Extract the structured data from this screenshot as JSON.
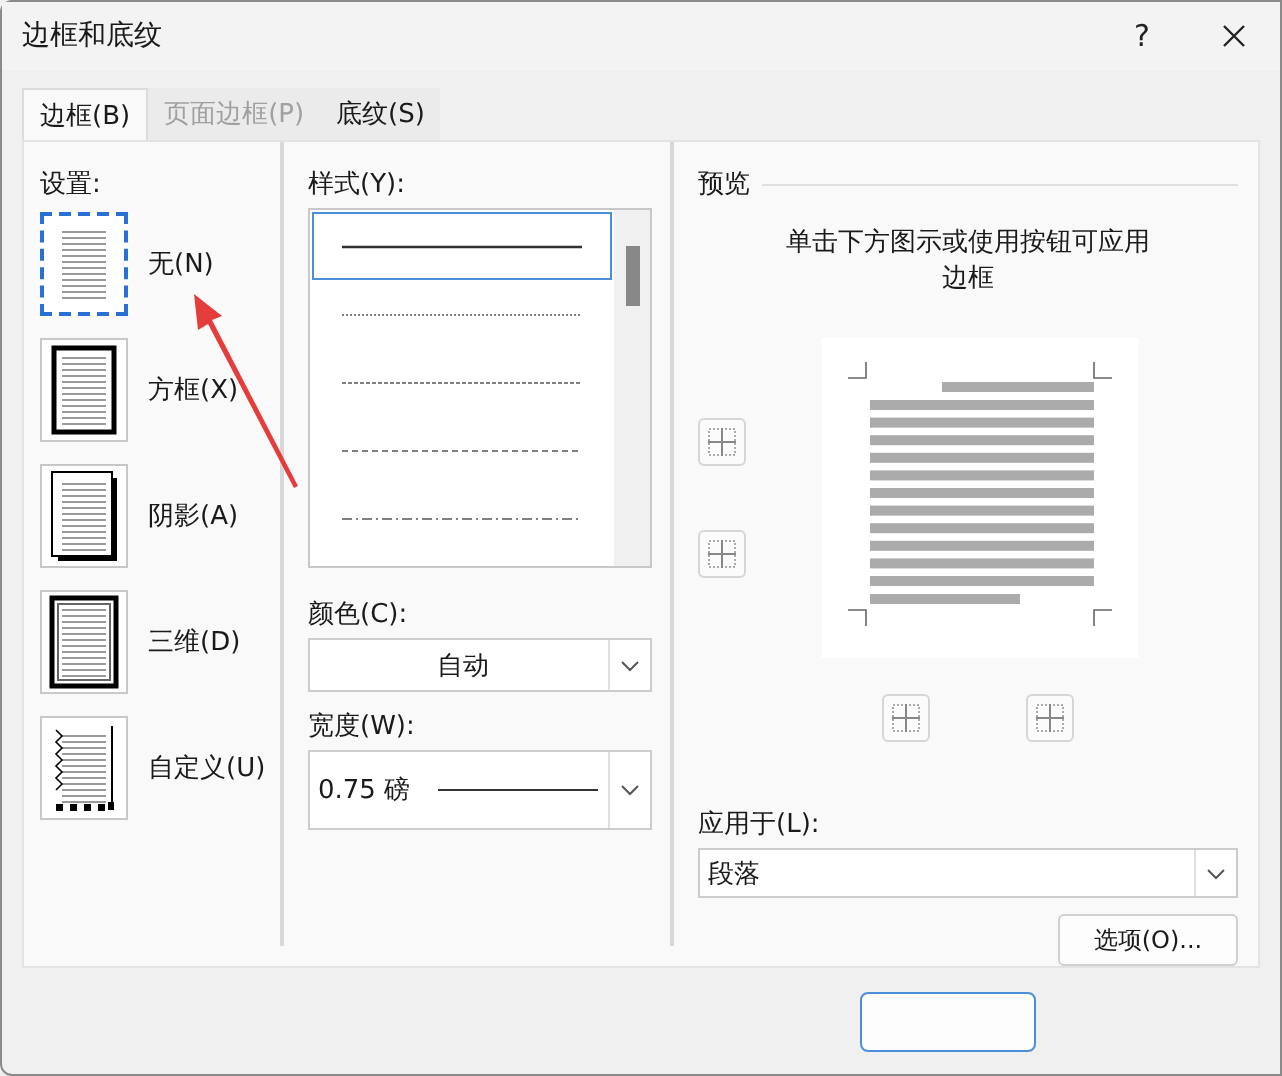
{
  "window": {
    "title": "边框和底纹",
    "help": "?"
  },
  "tabs": [
    {
      "label": "边框(B)",
      "selected": true,
      "disabled": false
    },
    {
      "label": "页面边框(P)",
      "selected": false,
      "disabled": true
    },
    {
      "label": "底纹(S)",
      "selected": false,
      "disabled": false
    }
  ],
  "settings": {
    "label": "设置:",
    "items": [
      {
        "label": "无(N)",
        "kind": "none",
        "selected": true
      },
      {
        "label": "方框(X)",
        "kind": "box",
        "selected": false
      },
      {
        "label": "阴影(A)",
        "kind": "shadow",
        "selected": false
      },
      {
        "label": "三维(D)",
        "kind": "threed",
        "selected": false
      },
      {
        "label": "自定义(U)",
        "kind": "custom",
        "selected": false
      }
    ]
  },
  "style": {
    "label": "样式(Y):",
    "items": [
      {
        "kind": "solid",
        "selected": true
      },
      {
        "kind": "dotted",
        "selected": false
      },
      {
        "kind": "fine-dashed",
        "selected": false
      },
      {
        "kind": "dashed",
        "selected": false
      },
      {
        "kind": "dash-dot",
        "selected": false
      }
    ]
  },
  "color": {
    "label": "颜色(C):",
    "value": "自动"
  },
  "width": {
    "label": "宽度(W):",
    "value": "0.75 磅"
  },
  "preview": {
    "label": "预览",
    "hint": "单击下方图示或使用按钮可应用边框"
  },
  "apply_to": {
    "label": "应用于(L):",
    "value": "段落"
  },
  "buttons": [
    {
      "kind": "options",
      "label": "选项(O)..."
    },
    {
      "kind": "ok"
    }
  ]
}
